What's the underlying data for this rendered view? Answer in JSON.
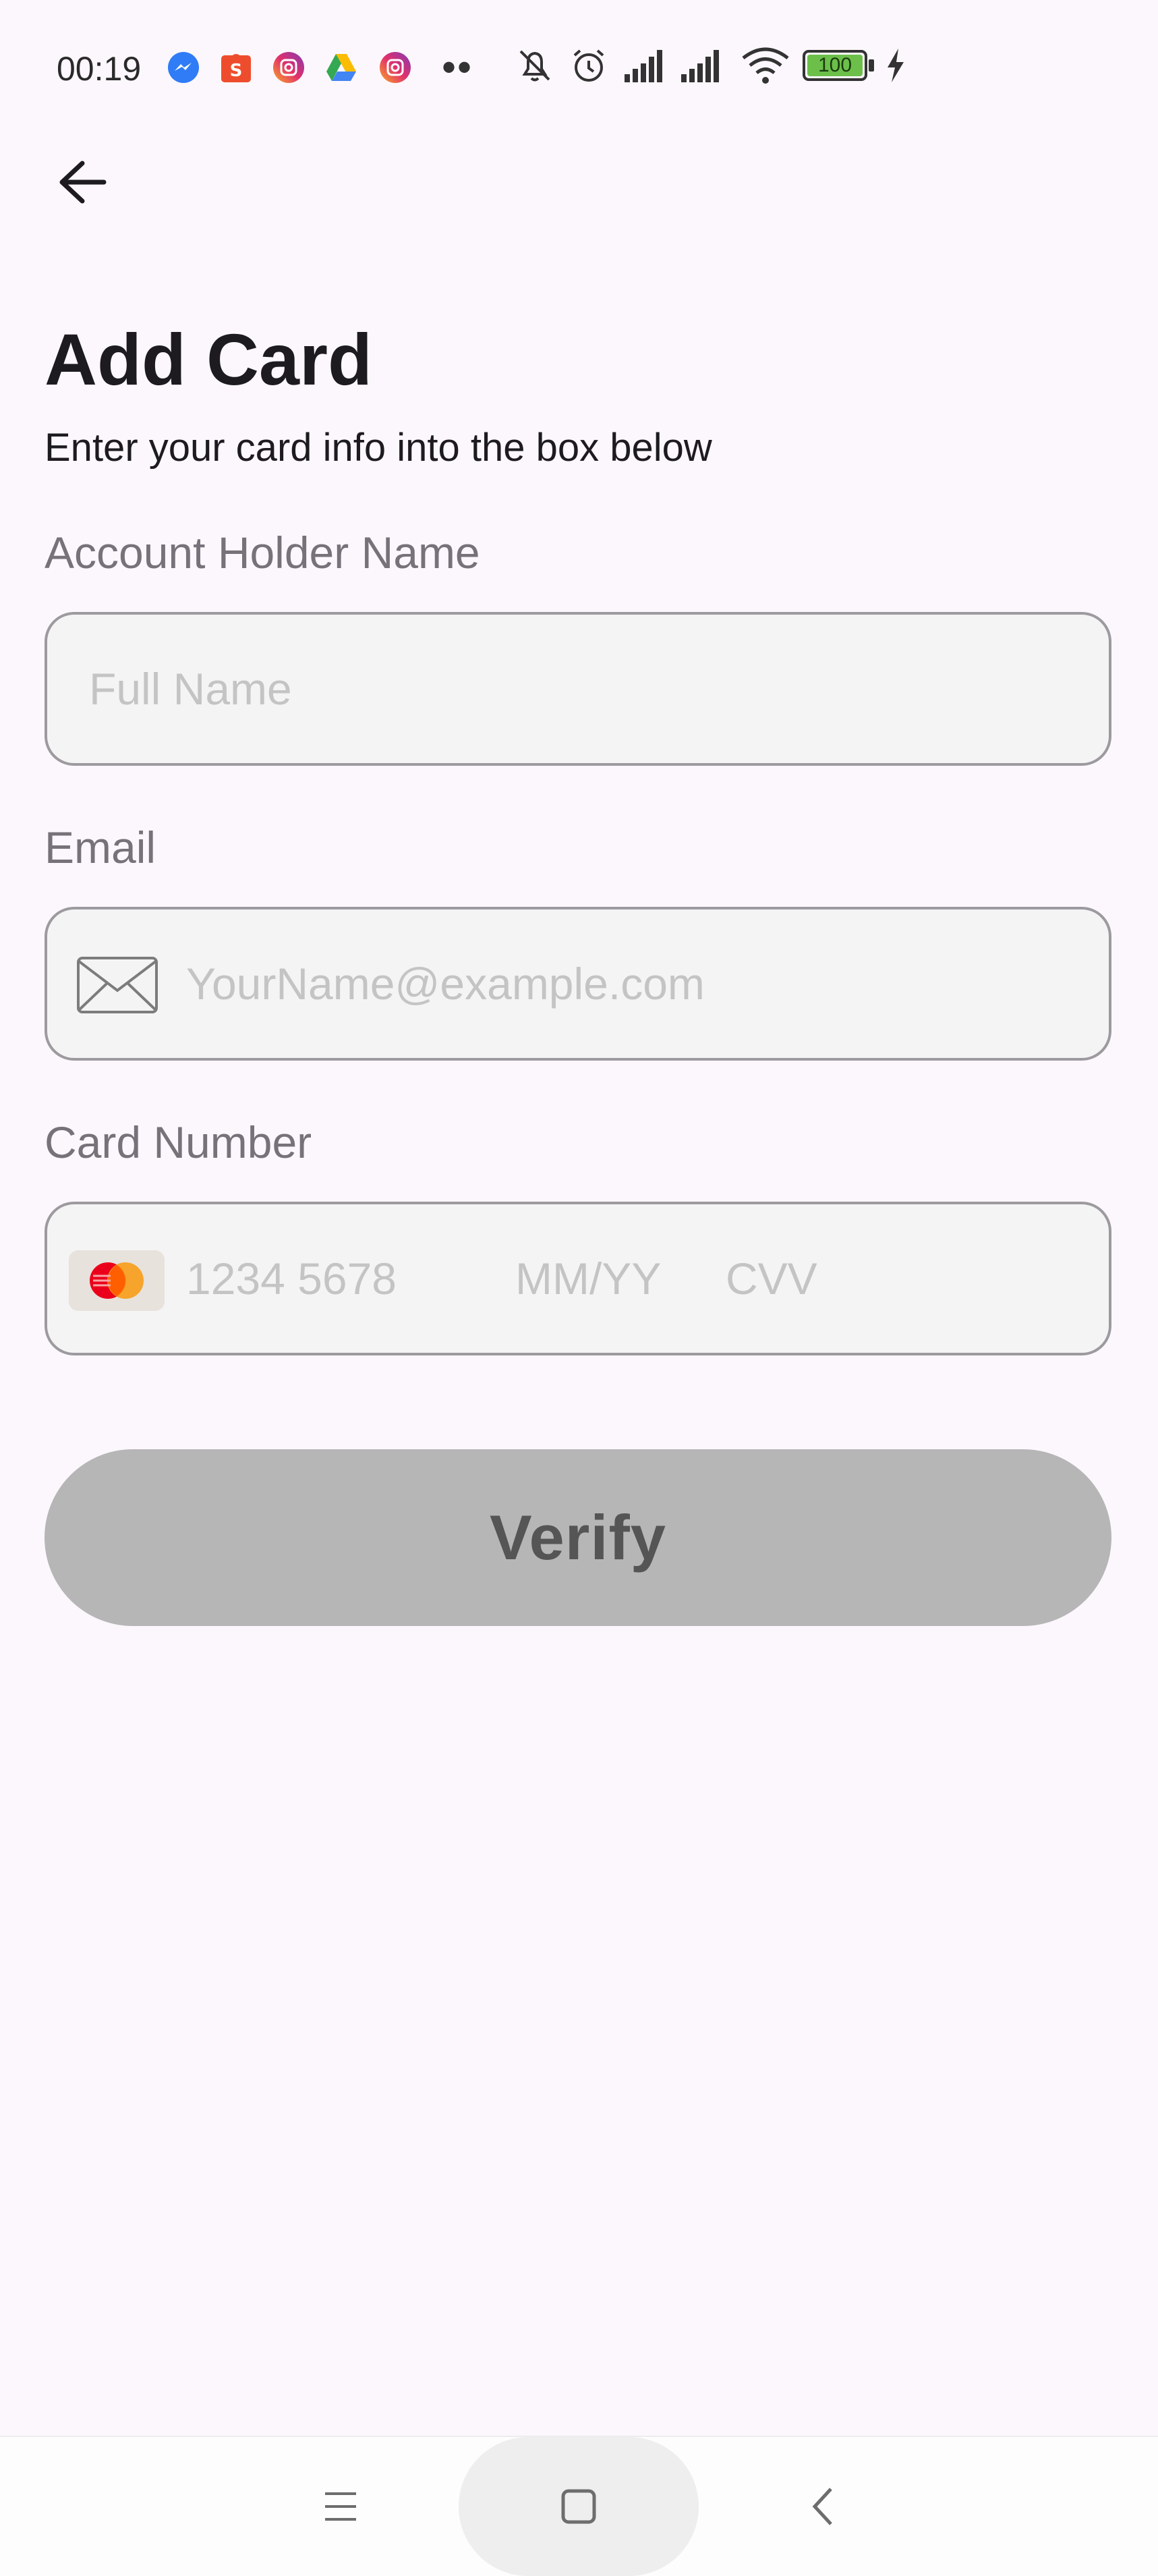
{
  "status_bar": {
    "time": "00:19",
    "battery_text": "100",
    "notification_icons": [
      "messenger-icon",
      "shopee-icon",
      "instagram-icon",
      "google-drive-icon",
      "instagram-icon"
    ],
    "system_icons": [
      "mute-bell-icon",
      "alarm-icon",
      "signal-icon",
      "signal-icon",
      "wifi-icon",
      "battery-icon",
      "charging-icon"
    ],
    "overflow": "••"
  },
  "header": {
    "title": "Add Card",
    "subtitle": "Enter your card info into the box below"
  },
  "form": {
    "name_label": "Account Holder Name",
    "name_placeholder": "Full Name",
    "email_label": "Email",
    "email_placeholder": "YourName@example.com",
    "card_label": "Card Number",
    "card_number_placeholder": "1234 5678",
    "expiry_placeholder": "MM/YY",
    "cvv_placeholder": "CVV"
  },
  "actions": {
    "verify_label": "Verify"
  },
  "colors": {
    "background": "#fcf7fc",
    "field_background": "#f4f4f4",
    "field_border": "#9d9a9f",
    "button_disabled": "#b6b6b6",
    "battery_fill": "#6cc04a",
    "mastercard_red": "#eb001b",
    "mastercard_orange": "#f79e1b"
  }
}
